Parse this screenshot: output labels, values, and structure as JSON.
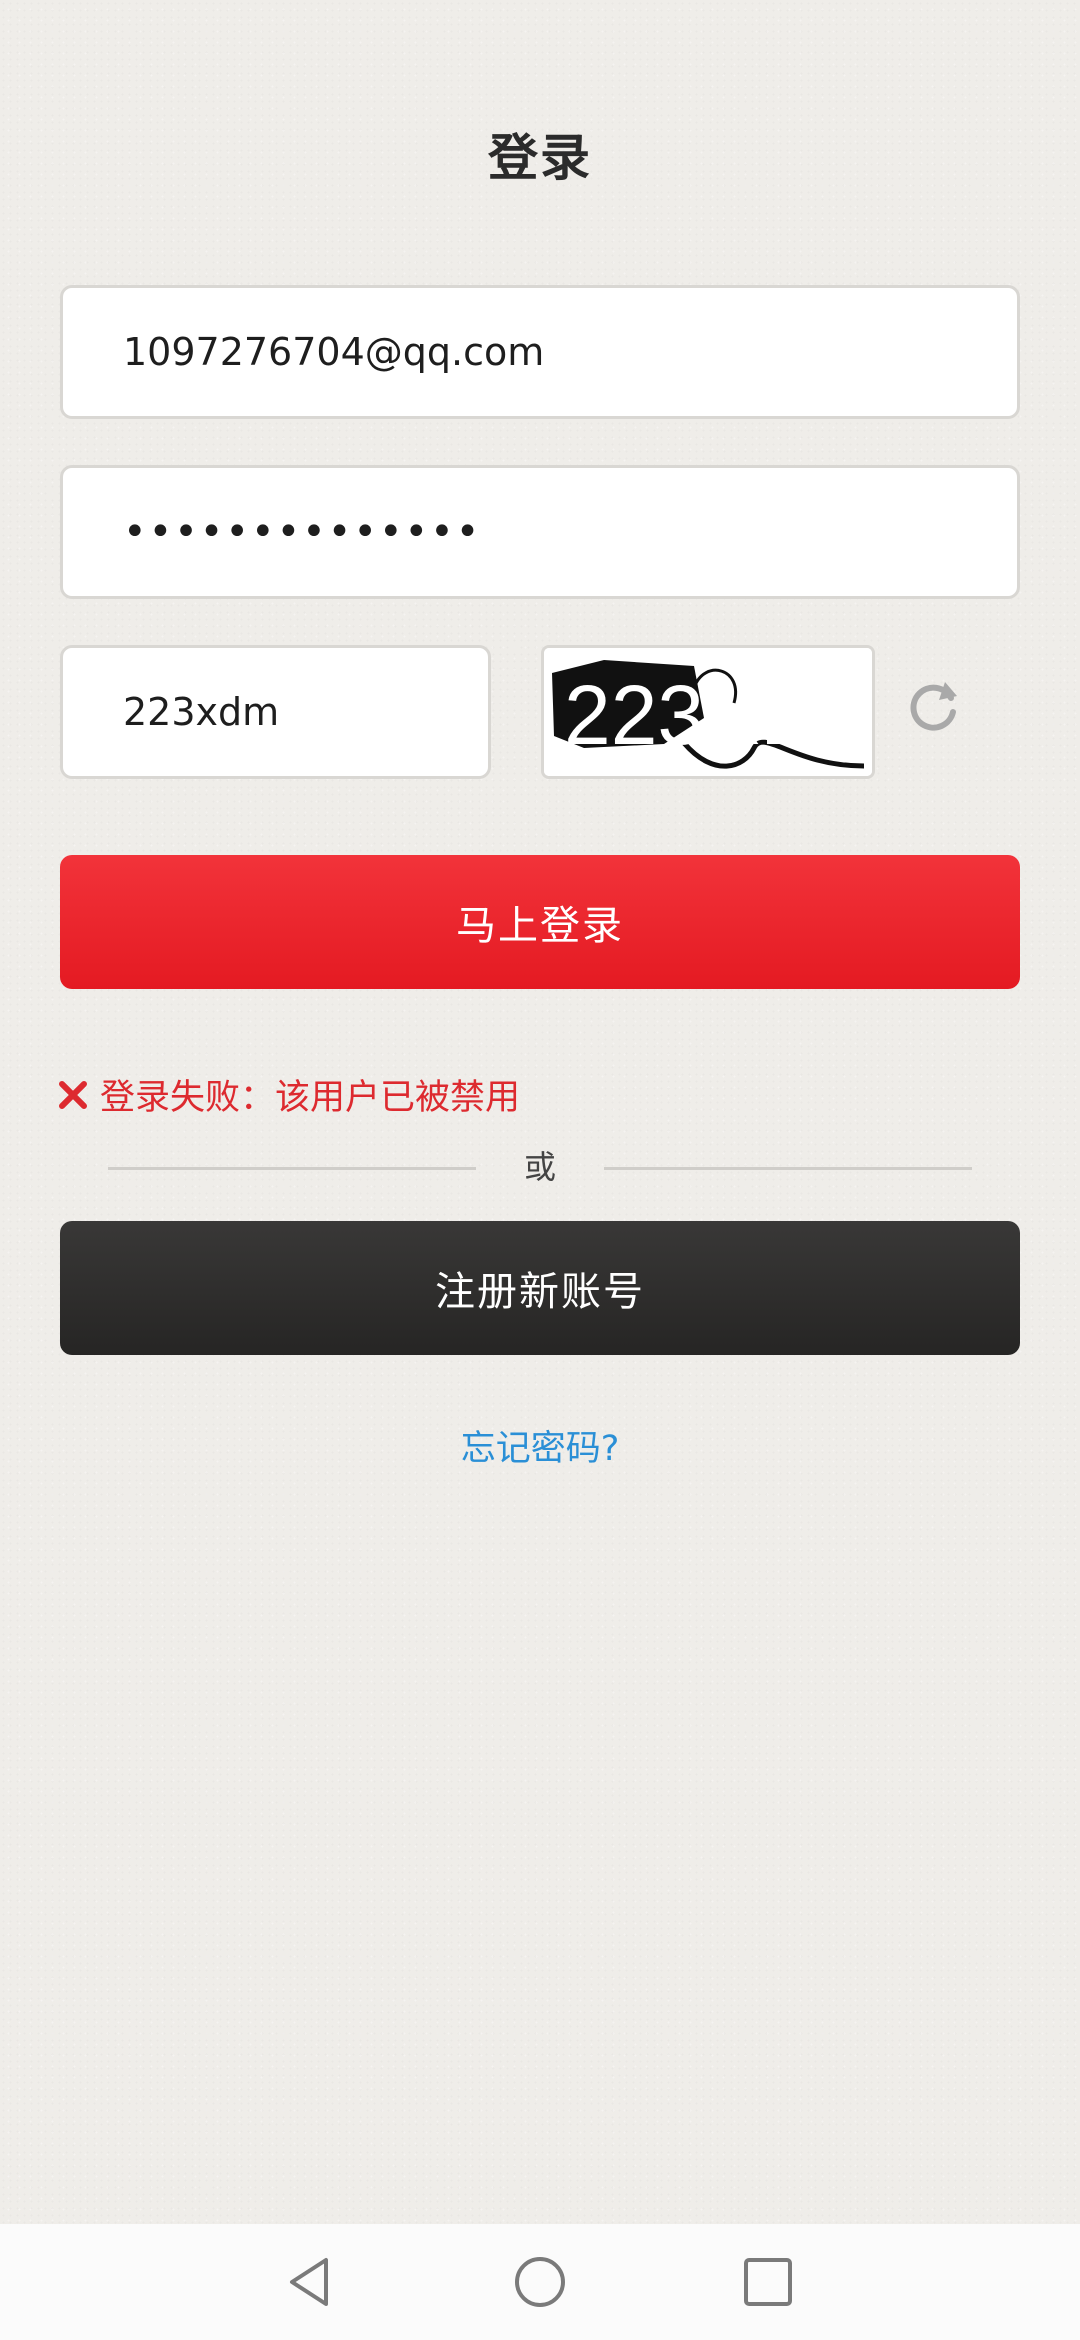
{
  "header": {
    "title": "登录"
  },
  "form": {
    "email_value": "1097276704@qq.com",
    "password_value": "••••••••••••••",
    "captcha_value": "223xdm",
    "captcha_image_text": "223XDM",
    "login_label": "马上登录",
    "error_text": "登录失败：该用户已被禁用",
    "divider_text": "或",
    "register_label": "注册新账号",
    "forgot_label": "忘记密码?"
  },
  "icons": {
    "refresh": "refresh-icon",
    "error": "close-icon",
    "nav_back": "triangle-back-icon",
    "nav_home": "circle-home-icon",
    "nav_recents": "square-recents-icon"
  },
  "colors": {
    "primary_red": "#e41a22",
    "dark_button": "#2d2c2b",
    "error_red": "#dd2a2f",
    "link_blue": "#2a8fd6",
    "background": "#efede9"
  }
}
